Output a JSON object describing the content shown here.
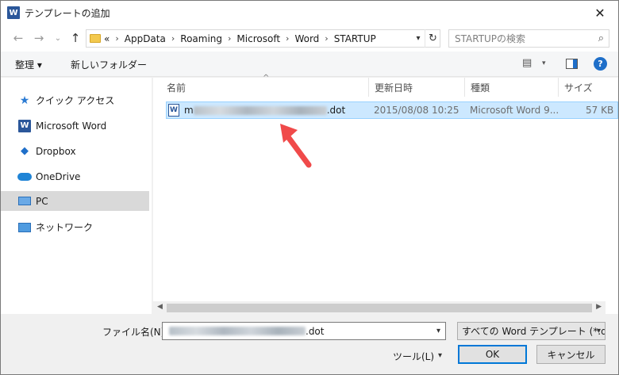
{
  "window": {
    "title": "テンプレートの追加",
    "app_icon_letter": "W",
    "close_glyph": "✕"
  },
  "address": {
    "overflow": "«",
    "crumbs": [
      "AppData",
      "Roaming",
      "Microsoft",
      "Word",
      "STARTUP"
    ],
    "search_placeholder": "STARTUPの検索"
  },
  "toolbar": {
    "organize": "整理 ▾",
    "new_folder": "新しいフォルダー"
  },
  "sidebar": {
    "items": [
      {
        "label": "クイック アクセス",
        "icon": "star-icon"
      },
      {
        "label": "Microsoft Word",
        "icon": "word-icon"
      },
      {
        "label": "Dropbox",
        "icon": "dropbox-icon"
      },
      {
        "label": "OneDrive",
        "icon": "cloud-icon"
      },
      {
        "label": "PC",
        "icon": "pc-icon"
      },
      {
        "label": "ネットワーク",
        "icon": "network-icon"
      }
    ]
  },
  "columns": {
    "name": "名前",
    "modified": "更新日時",
    "type": "種類",
    "size": "サイズ"
  },
  "files": [
    {
      "name_prefix": "m",
      "name_suffix": ".dot",
      "modified": "2015/08/08 10:25",
      "type": "Microsoft Word 9...",
      "size": "57 KB",
      "icon": "word-doc-icon"
    }
  ],
  "footer": {
    "filename_label": "ファイル名(N):",
    "filename_suffix": ".dot",
    "filetype": "すべての Word テンプレート (*.dotx",
    "tools": "ツール(L)",
    "ok": "OK",
    "cancel": "キャンセル"
  },
  "colors": {
    "selection_bg": "#cce8ff",
    "selection_border": "#99d1ff",
    "annotation_arrow": "#f04a4a",
    "accent": "#0078d7"
  }
}
